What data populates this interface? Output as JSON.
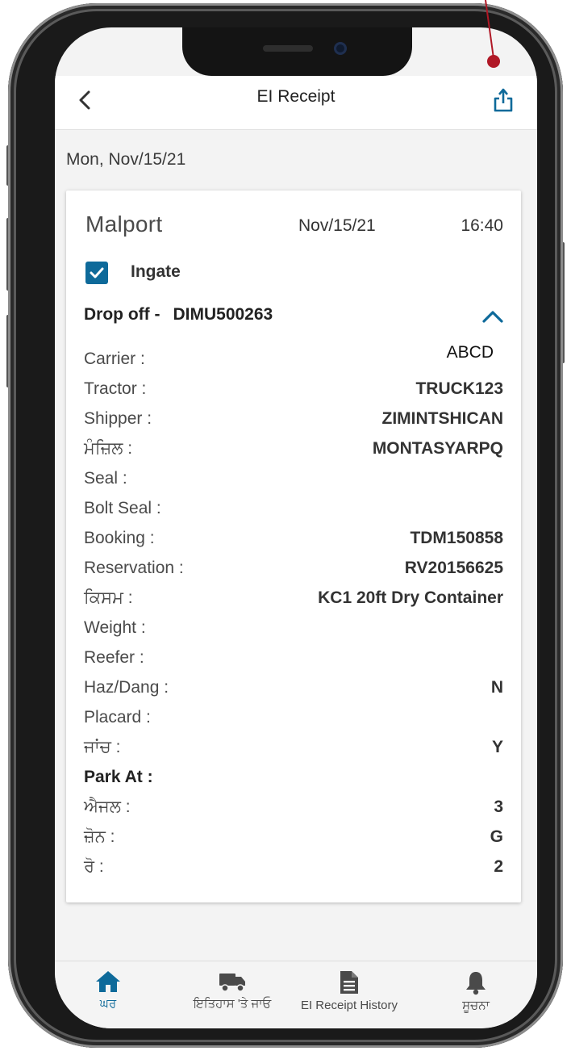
{
  "header": {
    "title": "EI Receipt"
  },
  "date_line": "Mon, Nov/15/21",
  "card": {
    "brand": "Malport",
    "date": "Nov/15/21",
    "time": "16:40",
    "ingate_label": "Ingate",
    "ingate_checked": true,
    "drop_label": "Drop off -",
    "container_id": "DIMU500263",
    "fields": [
      {
        "label": "Carrier :",
        "value": "ABCD"
      },
      {
        "label": "Tractor :",
        "value": "TRUCK123"
      },
      {
        "label": "Shipper :",
        "value": "ZIMINTSHICAN"
      },
      {
        "label": "ਮੰਜ਼ਿਲ :",
        "value": "MONTASYARPQ"
      },
      {
        "label": "Seal :",
        "value": ""
      },
      {
        "label": "Bolt Seal :",
        "value": ""
      },
      {
        "label": "Booking :",
        "value": "TDM150858"
      },
      {
        "label": "Reservation :",
        "value": "RV20156625"
      },
      {
        "label": "ਕਿਸਮ :",
        "value": "KC1 20ft Dry Container"
      },
      {
        "label": "Weight :",
        "value": ""
      },
      {
        "label": "Reefer :",
        "value": ""
      },
      {
        "label": "Haz/Dang :",
        "value": "N"
      },
      {
        "label": "Placard :",
        "value": ""
      },
      {
        "label": "ਜਾਂਚ :",
        "value": "Y"
      },
      {
        "label": "Park At :",
        "value": ""
      },
      {
        "label": "ਐਜਲ :",
        "value": "3"
      },
      {
        "label": "ਜ਼ੋਨ :",
        "value": "G"
      },
      {
        "label": "ਰੋ :",
        "value": "2"
      }
    ]
  },
  "bottom_nav": [
    {
      "label": "ਘਰ",
      "icon": "home-icon",
      "active": true
    },
    {
      "label": "ਇਤਿਹਾਸ 'ਤੇ ਜਾਓ",
      "icon": "truck-icon",
      "active": false
    },
    {
      "label": "EI Receipt History",
      "icon": "document-icon",
      "active": false
    },
    {
      "label": "ਸੂਚਨਾ",
      "icon": "bell-icon",
      "active": false
    }
  ],
  "colors": {
    "accent": "#0e6a9a",
    "annotation": "#b01826",
    "background": "#f3f3f3"
  }
}
